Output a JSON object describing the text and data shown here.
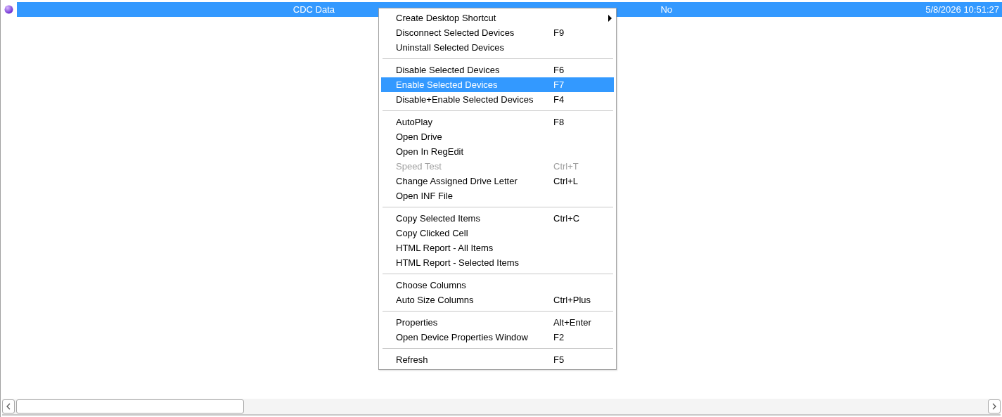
{
  "row": {
    "selected": true,
    "cells": [
      "CDC Data",
      "No",
      "5/8/2026 10:51:27"
    ]
  },
  "menu": {
    "sections": [
      [
        {
          "label": "Create Desktop Shortcut",
          "submenu": true,
          "disabled": false,
          "selected": false
        },
        {
          "label": "Disconnect Selected Devices",
          "shortcut": "F9",
          "submenu": false,
          "disabled": false,
          "selected": false
        },
        {
          "label": "Uninstall Selected Devices",
          "submenu": false,
          "disabled": false,
          "selected": false
        }
      ],
      [
        {
          "label": "Disable Selected Devices",
          "shortcut": "F6",
          "submenu": false,
          "disabled": false,
          "selected": false
        },
        {
          "label": "Enable Selected Devices",
          "shortcut": "F7",
          "submenu": false,
          "disabled": false,
          "selected": true
        },
        {
          "label": "Disable+Enable Selected Devices",
          "shortcut": "F4",
          "submenu": false,
          "disabled": false,
          "selected": false
        }
      ],
      [
        {
          "label": "AutoPlay",
          "shortcut": "F8",
          "submenu": false,
          "disabled": false,
          "selected": false
        },
        {
          "label": "Open Drive",
          "submenu": false,
          "disabled": false,
          "selected": false
        },
        {
          "label": "Open In RegEdit",
          "submenu": false,
          "disabled": false,
          "selected": false
        },
        {
          "label": "Speed Test",
          "shortcut": "Ctrl+T",
          "submenu": false,
          "disabled": true,
          "selected": false
        },
        {
          "label": "Change Assigned Drive Letter",
          "shortcut": "Ctrl+L",
          "submenu": false,
          "disabled": false,
          "selected": false
        },
        {
          "label": "Open INF File",
          "submenu": false,
          "disabled": false,
          "selected": false
        }
      ],
      [
        {
          "label": "Copy Selected Items",
          "shortcut": "Ctrl+C",
          "submenu": false,
          "disabled": false,
          "selected": false
        },
        {
          "label": "Copy Clicked Cell",
          "submenu": false,
          "disabled": false,
          "selected": false
        },
        {
          "label": "HTML Report - All Items",
          "submenu": false,
          "disabled": false,
          "selected": false
        },
        {
          "label": "HTML Report - Selected Items",
          "submenu": false,
          "disabled": false,
          "selected": false
        }
      ],
      [
        {
          "label": "Choose Columns",
          "submenu": false,
          "disabled": false,
          "selected": false
        },
        {
          "label": "Auto Size Columns",
          "shortcut": "Ctrl+Plus",
          "submenu": false,
          "disabled": false,
          "selected": false
        }
      ],
      [
        {
          "label": "Properties",
          "shortcut": "Alt+Enter",
          "submenu": false,
          "disabled": false,
          "selected": false
        },
        {
          "label": "Open Device Properties Window",
          "shortcut": "F2",
          "submenu": false,
          "disabled": false,
          "selected": false
        }
      ],
      [
        {
          "label": "Refresh",
          "shortcut": "F5",
          "submenu": false,
          "disabled": false,
          "selected": false
        }
      ]
    ]
  }
}
